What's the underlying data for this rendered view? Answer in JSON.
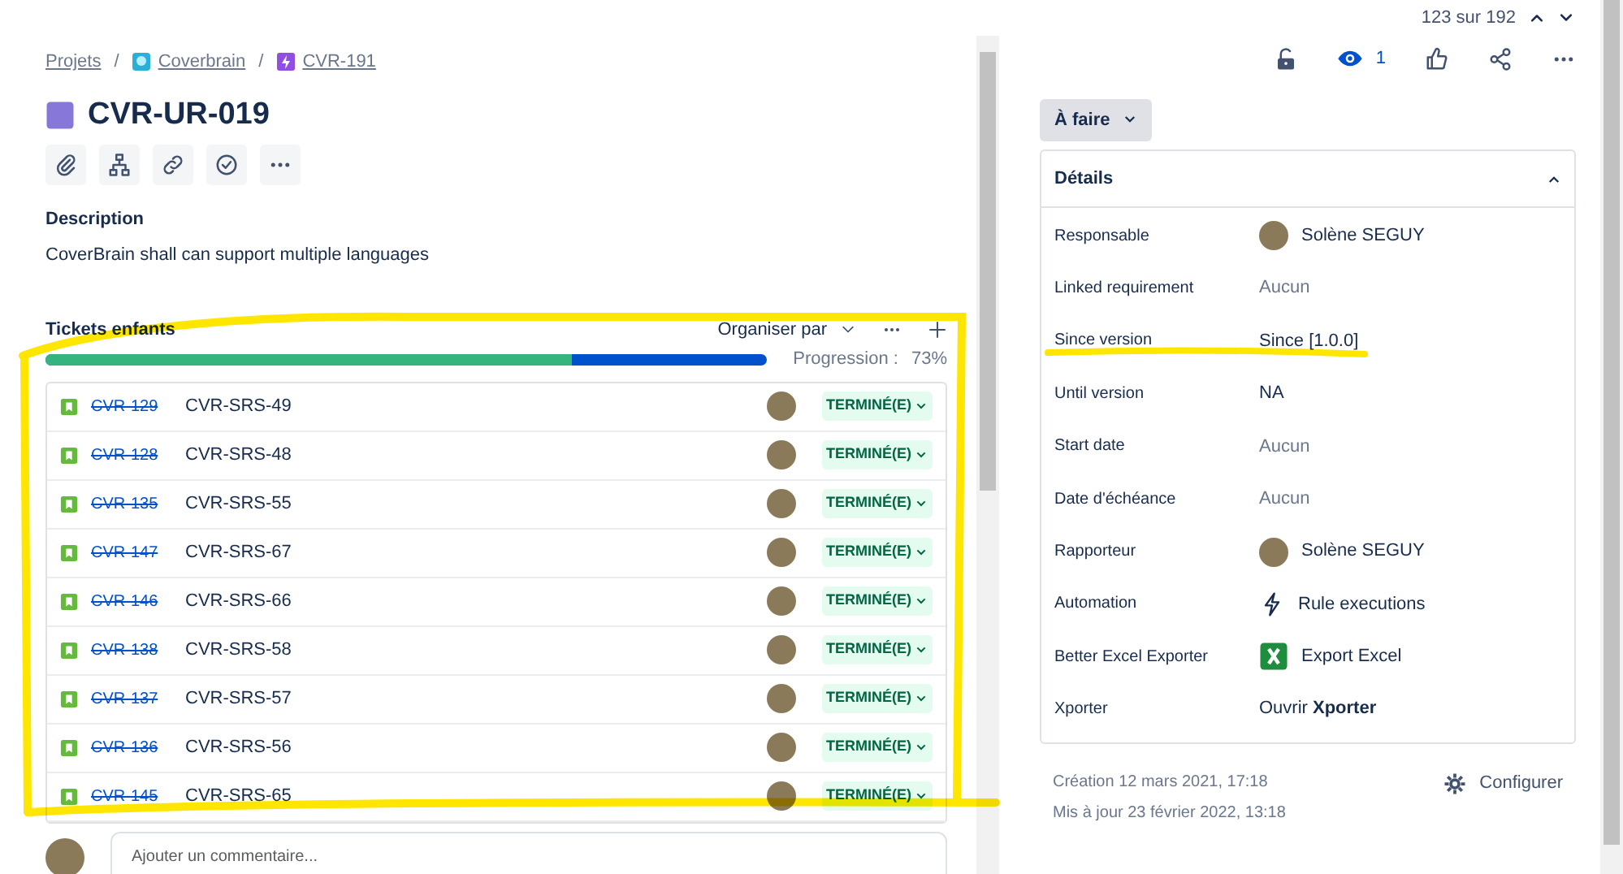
{
  "pagination": {
    "text": "123 sur 192"
  },
  "breadcrumbs": [
    {
      "label": "Projets",
      "kind": "link"
    },
    {
      "label": "Coverbrain",
      "kind": "project"
    },
    {
      "label": "CVR-191",
      "kind": "epic"
    }
  ],
  "breadcrumb_separators": [
    "/",
    "/"
  ],
  "issue": {
    "key": "CVR-UR-019"
  },
  "description": {
    "heading": "Description",
    "text": "CoverBrain shall can support multiple languages"
  },
  "child_issues": {
    "title": "Tickets enfants",
    "organize_label": "Organiser par",
    "progress_label": "Progression :",
    "progress_value": "73%",
    "level": 0.73,
    "rows": [
      {
        "key": "CVR-129",
        "summary": "CVR-SRS-49",
        "status": "TERMINÉ(E)",
        "done": true
      },
      {
        "key": "CVR-128",
        "summary": "CVR-SRS-48",
        "status": "TERMINÉ(E)",
        "done": true
      },
      {
        "key": "CVR-135",
        "summary": "CVR-SRS-55",
        "status": "TERMINÉ(E)",
        "done": true
      },
      {
        "key": "CVR-147",
        "summary": "CVR-SRS-67",
        "status": "TERMINÉ(E)",
        "done": true
      },
      {
        "key": "CVR-146",
        "summary": "CVR-SRS-66",
        "status": "TERMINÉ(E)",
        "done": true
      },
      {
        "key": "CVR-138",
        "summary": "CVR-SRS-58",
        "status": "TERMINÉ(E)",
        "done": true
      },
      {
        "key": "CVR-137",
        "summary": "CVR-SRS-57",
        "status": "TERMINÉ(E)",
        "done": true
      },
      {
        "key": "CVR-136",
        "summary": "CVR-SRS-56",
        "status": "TERMINÉ(E)",
        "done": true
      },
      {
        "key": "CVR-145",
        "summary": "CVR-SRS-65",
        "status": "TERMINÉ(E)",
        "done": true
      }
    ]
  },
  "comment": {
    "placeholder": "Ajouter un commentaire..."
  },
  "watchers": {
    "count": "1"
  },
  "status_button": {
    "label": "À faire"
  },
  "details": {
    "title": "Détails",
    "expanded": true,
    "fields": [
      {
        "label": "Responsable",
        "value": "Solène SEGUY",
        "kind": "person"
      },
      {
        "label": "Linked requirement",
        "value": "Aucun",
        "kind": "empty"
      },
      {
        "label": "Since version",
        "value": "Since [1.0.0]",
        "kind": "text"
      },
      {
        "label": "Until version",
        "value": "NA",
        "kind": "text"
      },
      {
        "label": "Start date",
        "value": "Aucun",
        "kind": "empty"
      },
      {
        "label": "Date d'échéance",
        "value": "Aucun",
        "kind": "empty"
      },
      {
        "label": "Rapporteur",
        "value": "Solène SEGUY",
        "kind": "person"
      },
      {
        "label": "Automation",
        "value": "Rule executions",
        "kind": "automation"
      },
      {
        "label": "Better Excel Exporter",
        "value": "Export Excel",
        "kind": "excel"
      },
      {
        "label": "Xporter",
        "value": "Ouvrir **Xporter**",
        "kind": "rich"
      }
    ]
  },
  "footer": {
    "created": "Création 12 mars 2021, 17:18",
    "updated": "Mis à jour 23 février 2022, 13:18",
    "configure": "Configurer"
  }
}
